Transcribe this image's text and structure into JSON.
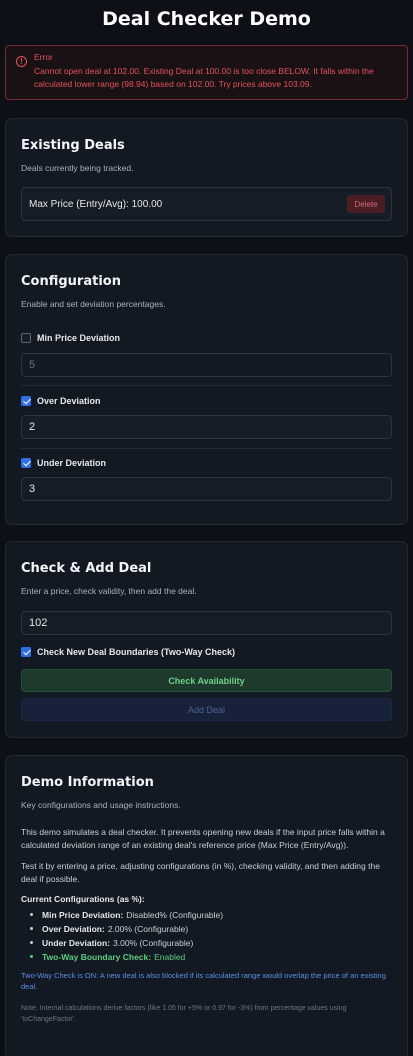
{
  "page_title": "Deal Checker Demo",
  "error": {
    "title": "Error",
    "message": "Cannot open deal at 102.00. Existing Deal at 100.00 is too close BELOW. It falls within the calculated lower range (98.94) based on 102.00. Try prices above 103.09.",
    "icon": "alert-circle-icon"
  },
  "existing_deals": {
    "title": "Existing Deals",
    "subtitle": "Deals currently being tracked.",
    "deals": [
      {
        "label": "Max Price (Entry/Avg): 100.00",
        "delete_label": "Delete"
      }
    ]
  },
  "configuration": {
    "title": "Configuration",
    "subtitle": "Enable and set deviation percentages.",
    "min_price": {
      "label": "Min Price Deviation",
      "checked": false,
      "value": "5"
    },
    "over": {
      "label": "Over Deviation",
      "checked": true,
      "value": "2"
    },
    "under": {
      "label": "Under Deviation",
      "checked": true,
      "value": "3"
    }
  },
  "check_add": {
    "title": "Check & Add Deal",
    "subtitle": "Enter a price, check validity, then add the deal.",
    "price_value": "102",
    "two_way_label": "Check New Deal Boundaries (Two-Way Check)",
    "two_way_checked": true,
    "check_button": "Check Availability",
    "add_button": "Add Deal"
  },
  "demo_info": {
    "title": "Demo Information",
    "subtitle": "Key configurations and usage instructions.",
    "para1": "This demo simulates a deal checker. It prevents opening new deals if the input price falls within a calculated deviation range of an existing deal's reference price (Max Price (Entry/Avg)).",
    "para2": "Test it by entering a price, adjusting configurations (in %), checking validity, and then adding the deal if possible.",
    "configs_heading": "Current Configurations (as %):",
    "configs": [
      {
        "key": "Min Price Deviation:",
        "value": "Disabled% (Configurable)"
      },
      {
        "key": "Over Deviation:",
        "value": "2.00% (Configurable)"
      },
      {
        "key": "Under Deviation:",
        "value": "3.00% (Configurable)"
      },
      {
        "key": "Two-Way Boundary Check:",
        "value": "Enabled"
      }
    ],
    "two_way_note": "Two-Way Check is ON: A new deal is also blocked if its calculated range would overlap the price of an existing deal.",
    "internal_note": "Note: Internal calculations derive factors (like 1.05 for +5% or 0.97 for -3%) from percentage values using 'toChangeFactor'."
  },
  "colors": {
    "background": "#0d1117",
    "error": "#e0545c",
    "accent_green": "#5ecb7c",
    "accent_blue": "#2f6fe4"
  }
}
